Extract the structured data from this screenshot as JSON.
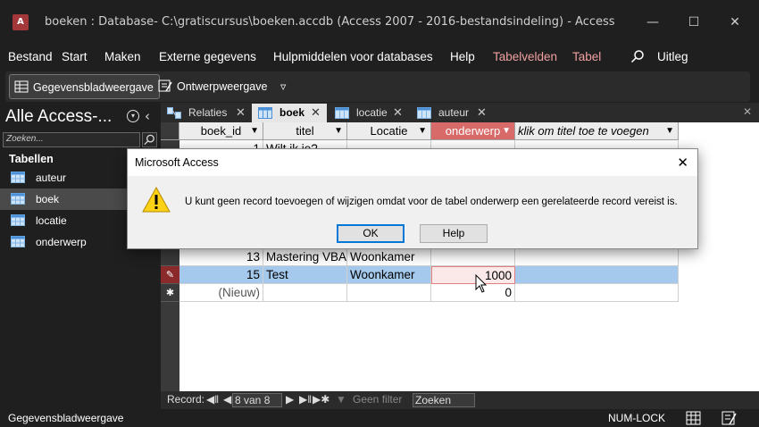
{
  "window": {
    "title": "boeken : Database- C:\\gratiscursus\\boeken.accdb (Access 2007 - 2016-bestandsindeling)  -  Access",
    "app_letter": "A"
  },
  "menu": {
    "items": [
      "Bestand",
      "Start",
      "Maken",
      "Externe gegevens",
      "Hulpmiddelen voor databases",
      "Help",
      "Tabelvelden",
      "Tabel"
    ],
    "uitleg": "Uitleg"
  },
  "ribbon": {
    "datasheet_view": "Gegevensbladweergave",
    "design_view": "Ontwerpweergave",
    "more": "▿"
  },
  "nav": {
    "title": "Alle Access-...",
    "search_placeholder": "Zoeken...",
    "group": "Tabellen",
    "items": [
      "auteur",
      "boek",
      "locatie",
      "onderwerp"
    ]
  },
  "tabs": {
    "items": [
      "Relaties",
      "boek",
      "locatie",
      "auteur"
    ]
  },
  "grid": {
    "columns": [
      "boek_id",
      "titel",
      "Locatie",
      "onderwerp",
      "klik om titel toe te voegen"
    ],
    "hidden_row": {
      "id": "1",
      "title": "Wilt ik je?"
    },
    "rows": [
      {
        "id": "13",
        "title": "Mastering VBA",
        "location": "Woonkamer",
        "subject": ""
      },
      {
        "id": "15",
        "title": "Test",
        "location": "Woonkamer",
        "subject": "1000"
      }
    ],
    "new_row": {
      "label": "(Nieuw)",
      "subject": "0"
    },
    "row_marks": {
      "edit": "✎",
      "new": "✱"
    }
  },
  "record_nav": {
    "label": "Record:",
    "position": "8 van 8",
    "filter": "Geen filter",
    "search": "Zoeken"
  },
  "status": {
    "left": "Gegevensbladweergave",
    "numlock": "NUM-LOCK"
  },
  "dialog": {
    "title": "Microsoft Access",
    "message": "U kunt geen record toevoegen of wijzigen omdat voor de tabel onderwerp een gerelateerde record vereist is.",
    "ok": "OK",
    "help": "Help"
  },
  "colors": {
    "accent_red": "#a4373a",
    "context_tab": "#f0a0a0",
    "selected_header": "#d96a6a",
    "active_row": "#a5c9ec",
    "dialog_default_border": "#0078d7"
  }
}
